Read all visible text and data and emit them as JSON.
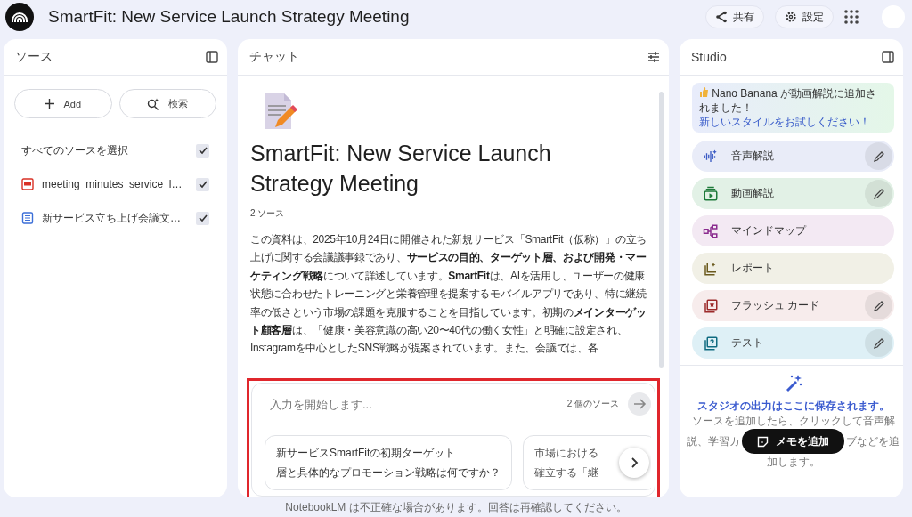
{
  "app": {
    "title": "SmartFit: New Service Launch Strategy Meeting"
  },
  "header_actions": [
    {
      "label": "共有",
      "kind": "share"
    },
    {
      "label": "設定",
      "kind": "settings"
    }
  ],
  "sources_panel": {
    "title": "ソース",
    "buttons": [
      {
        "label": "Add",
        "kind": "add"
      },
      {
        "label": "検索",
        "kind": "search"
      }
    ],
    "select_all": {
      "label": "すべてのソースを選択",
      "checked": true
    },
    "sources": [
      {
        "name": "meeting_minutes_service_l…",
        "kind": "pdf",
        "checked": true
      },
      {
        "name": "新サービス立ち上げ会議文…",
        "kind": "doc",
        "checked": true
      }
    ]
  },
  "chat": {
    "title": "チャット",
    "document": {
      "title": "SmartFit: New Service Launch Strategy Meeting",
      "source_count": "2 ソース",
      "summary": "この資料は、2025年10月24日に開催された新規サービス「SmartFit（仮称）」の立ち上げに関する会議議事録であり、**サービスの目的、ターゲット層、および開発・マーケティング戦略**について詳述しています。**SmartFit**は、AIを活用し、ユーザーの健康状態に合わせたトレーニングと栄養管理を提案するモバイルアプリであり、特に継続率の低さという市場の課題を克服することを目指しています。初期の**メインターゲット顧客層**は、「健康・美容意識の高い20〜40代の働く女性」と明確に設定され、Instagramを中心としたSNS戦略が提案されています。また、会議では、各"
    },
    "input": {
      "placeholder": "入力を開始します...",
      "source_count": "2 個のソース"
    },
    "suggestions": [
      {
        "lines": [
          "新サービスSmartFitの初期ターゲット",
          "層と具体的なプロモーション戦略は何ですか？"
        ]
      },
      {
        "lines": [
          "市場における",
          "確立する「継"
        ]
      }
    ]
  },
  "studio": {
    "title": "Studio",
    "banner": {
      "text": "Nano Banana が動画解説に追加されました！",
      "link": "新しいスタイルをお試しください！"
    },
    "tools": [
      {
        "label": "音声解説",
        "kind": "audio",
        "color": "#e9ecf8",
        "editable": true
      },
      {
        "label": "動画解説",
        "kind": "video",
        "color": "#e2f1e6",
        "editable": true
      },
      {
        "label": "マインドマップ",
        "kind": "mindmap",
        "color": "#f3e9f3",
        "editable": false
      },
      {
        "label": "レポート",
        "kind": "report",
        "color": "#f1f0e6",
        "editable": false
      },
      {
        "label": "フラッシュ カード",
        "kind": "flashcard",
        "color": "#f7ecec",
        "editable": true
      },
      {
        "label": "テスト",
        "kind": "quiz",
        "color": "#def0f6",
        "editable": true
      }
    ],
    "empty_title": "スタジオの出力はここに保存されます。",
    "empty_lines": [
      [
        "ソースを追加したら、クリックして音声解"
      ],
      [
        "説、学習カ",
        "ブなどを追"
      ],
      [
        "加します。"
      ]
    ],
    "add_note": "メモを追加"
  },
  "footer": "NotebookLM は不正確な場合があります。回答は再確認してください。"
}
